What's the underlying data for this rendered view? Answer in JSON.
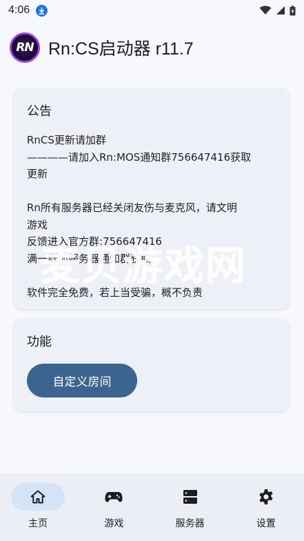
{
  "status_bar": {
    "time": "4:06"
  },
  "app_bar": {
    "logo_text": "RN",
    "title": "Rn:CS启动器 r11.7"
  },
  "notice": {
    "title": "公告",
    "lines": [
      "RnCS更新请加群",
      "————请加入Rn:MOS通知群756647416获取",
      "更新",
      "",
      "Rn所有服务器已经关闭友伤与麦克风，请文明",
      "游戏",
      "反馈进入官方群:756647416",
      "满一群加服务器通知群获取",
      "",
      "软件完全免费，若上当受骗，概不负责"
    ]
  },
  "features": {
    "title": "功能",
    "custom_room_button": "自定义房间"
  },
  "watermark": "麦贝游戏网",
  "bottom_nav": [
    {
      "label": "主页",
      "icon": "home-icon",
      "active": true
    },
    {
      "label": "游戏",
      "icon": "gamepad-icon",
      "active": false
    },
    {
      "label": "服务器",
      "icon": "server-icon",
      "active": false
    },
    {
      "label": "设置",
      "icon": "gear-icon",
      "active": false
    }
  ],
  "colors": {
    "accent": "#3b6590",
    "nav_active": "#d4e3f6",
    "card": "#eef0f7",
    "background": "#f7f8fc"
  }
}
